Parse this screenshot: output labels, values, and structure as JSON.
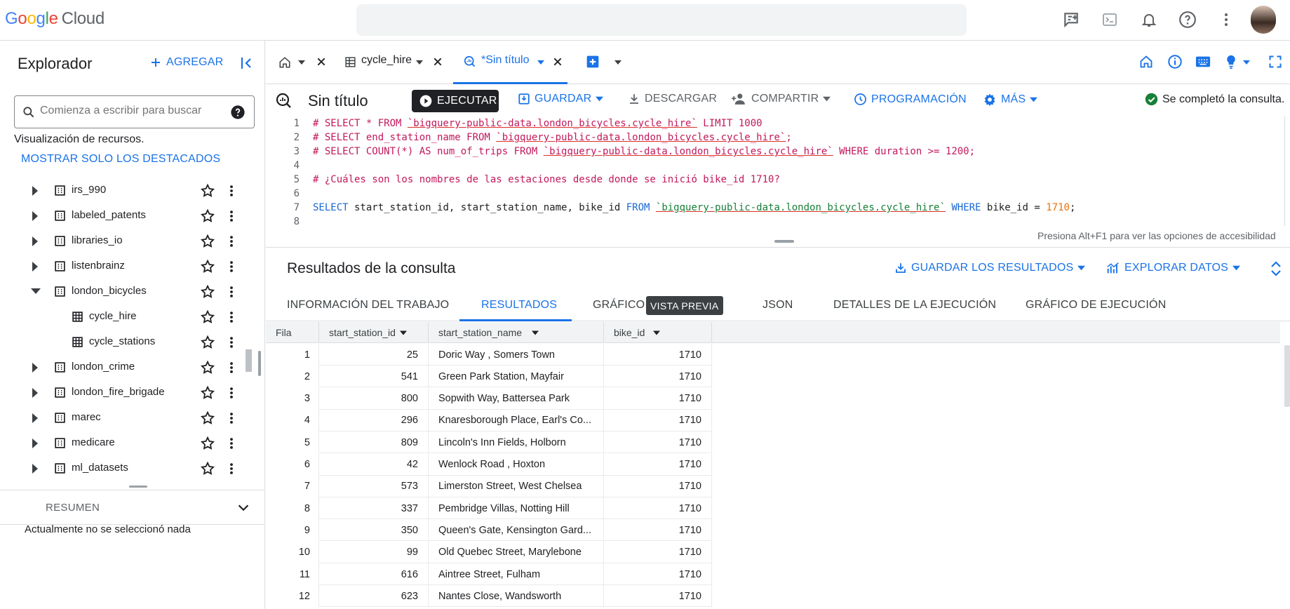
{
  "topbar": {
    "logo_chars": [
      "G",
      "o",
      "o",
      "g",
      "l",
      "e"
    ],
    "logo_suffix": "Cloud",
    "search_placeholder": "",
    "icons": [
      "release-notes-icon",
      "cloud-shell-icon",
      "notifications-icon",
      "help-icon",
      "more-vert-icon"
    ]
  },
  "explorer": {
    "title": "Explorador",
    "add_label": "AGREGAR",
    "search_placeholder": "Comienza a escribir para buscar",
    "resources_text": "Visualización de recursos.",
    "starred_link": "MOSTRAR SOLO LOS DESTACADOS",
    "tree": [
      {
        "name": "irs_990",
        "expanded": false,
        "level": 0
      },
      {
        "name": "labeled_patents",
        "expanded": false,
        "level": 0
      },
      {
        "name": "libraries_io",
        "expanded": false,
        "level": 0
      },
      {
        "name": "listenbrainz",
        "expanded": false,
        "level": 0
      },
      {
        "name": "london_bicycles",
        "expanded": true,
        "level": 0
      },
      {
        "name": "cycle_hire",
        "expanded": false,
        "level": 1
      },
      {
        "name": "cycle_stations",
        "expanded": false,
        "level": 1
      },
      {
        "name": "london_crime",
        "expanded": false,
        "level": 0
      },
      {
        "name": "london_fire_brigade",
        "expanded": false,
        "level": 0
      },
      {
        "name": "marec",
        "expanded": false,
        "level": 0
      },
      {
        "name": "medicare",
        "expanded": false,
        "level": 0
      },
      {
        "name": "ml_datasets",
        "expanded": false,
        "level": 0
      }
    ],
    "summary_label": "RESUMEN",
    "summary_empty": "Actualmente no se seleccionó nada"
  },
  "tabs": {
    "table_tab": "cycle_hire",
    "query_tab": "*Sin título"
  },
  "toolbar": {
    "query_title": "Sin título",
    "run": "EJECUTAR",
    "save": "GUARDAR",
    "download": "DESCARGAR",
    "share": "COMPARTIR",
    "schedule": "PROGRAMACIÓN",
    "more": "MÁS",
    "status": "Se completó la consulta."
  },
  "editor": {
    "lines": [
      {
        "n": "1",
        "parts": [
          {
            "t": "# SELECT * FROM ",
            "c": "comment"
          },
          {
            "t": "`bigquery-public-data.london_bicycles.cycle_hire`",
            "c": "cstr"
          },
          {
            "t": " LIMIT 1000",
            "c": "comment"
          }
        ]
      },
      {
        "n": "2",
        "parts": [
          {
            "t": "# SELECT end_station_name FROM ",
            "c": "comment"
          },
          {
            "t": "`bigquery-public-data.london_bicycles.cycle_hire`",
            "c": "cstr"
          },
          {
            "t": ";",
            "c": "comment"
          }
        ]
      },
      {
        "n": "3",
        "parts": [
          {
            "t": "# SELECT COUNT(*) AS num_of_trips FROM ",
            "c": "comment"
          },
          {
            "t": "`bigquery-public-data.london_bicycles.cycle_hire`",
            "c": "cstr"
          },
          {
            "t": " WHERE duration >= 1200;",
            "c": "comment"
          }
        ]
      },
      {
        "n": "4",
        "parts": []
      },
      {
        "n": "5",
        "parts": [
          {
            "t": "# ¿Cuáles son los nombres de las estaciones desde donde se inició bike_id 1710?",
            "c": "comment"
          }
        ]
      },
      {
        "n": "6",
        "parts": []
      },
      {
        "n": "7",
        "parts": [
          {
            "t": "SELECT",
            "c": "kw"
          },
          {
            "t": " start_station_id, start_station_name, bike_id ",
            "c": "plain"
          },
          {
            "t": "FROM",
            "c": "kw"
          },
          {
            "t": " ",
            "c": "plain"
          },
          {
            "t": "`bigquery-public-data.london_bicycles.cycle_hire`",
            "c": "str"
          },
          {
            "t": " ",
            "c": "plain"
          },
          {
            "t": "WHERE",
            "c": "kw"
          },
          {
            "t": " bike_id = ",
            "c": "plain"
          },
          {
            "t": "1710",
            "c": "num"
          },
          {
            "t": ";",
            "c": "plain"
          }
        ]
      },
      {
        "n": "8",
        "parts": []
      }
    ],
    "accessibility_hint": "Presiona Alt+F1 para ver las opciones de accesibilidad"
  },
  "results": {
    "title": "Resultados de la consulta",
    "save_results": "GUARDAR LOS RESULTADOS",
    "explore_data": "EXPLORAR DATOS",
    "tabs": [
      "INFORMACIÓN DEL TRABAJO",
      "RESULTADOS",
      "GRÁFICO",
      "JSON",
      "DETALLES DE LA EJECUCIÓN",
      "GRÁFICO DE EJECUCIÓN"
    ],
    "preview_badge": "VISTA PREVIA",
    "columns": [
      "Fila",
      "start_station_id",
      "start_station_name",
      "bike_id"
    ],
    "rows": [
      [
        "1",
        "25",
        "Doric Way , Somers Town",
        "1710"
      ],
      [
        "2",
        "541",
        "Green Park Station, Mayfair",
        "1710"
      ],
      [
        "3",
        "800",
        "Sopwith Way, Battersea Park",
        "1710"
      ],
      [
        "4",
        "296",
        "Knaresborough Place, Earl's Co...",
        "1710"
      ],
      [
        "5",
        "809",
        "Lincoln's Inn Fields, Holborn",
        "1710"
      ],
      [
        "6",
        "42",
        "Wenlock Road , Hoxton",
        "1710"
      ],
      [
        "7",
        "573",
        "Limerston Street, West Chelsea",
        "1710"
      ],
      [
        "8",
        "337",
        "Pembridge Villas, Notting Hill",
        "1710"
      ],
      [
        "9",
        "350",
        "Queen's Gate, Kensington Gard...",
        "1710"
      ],
      [
        "10",
        "99",
        "Old Quebec Street, Marylebone",
        "1710"
      ],
      [
        "11",
        "616",
        "Aintree Street, Fulham",
        "1710"
      ],
      [
        "12",
        "623",
        "Nantes Close, Wandsworth",
        "1710"
      ]
    ]
  },
  "colors": {
    "accent": "#1a73e8",
    "comment": "#c2185b",
    "keyword": "#1967d2",
    "string": "#188038",
    "number": "#e8710a",
    "success": "#188038"
  }
}
